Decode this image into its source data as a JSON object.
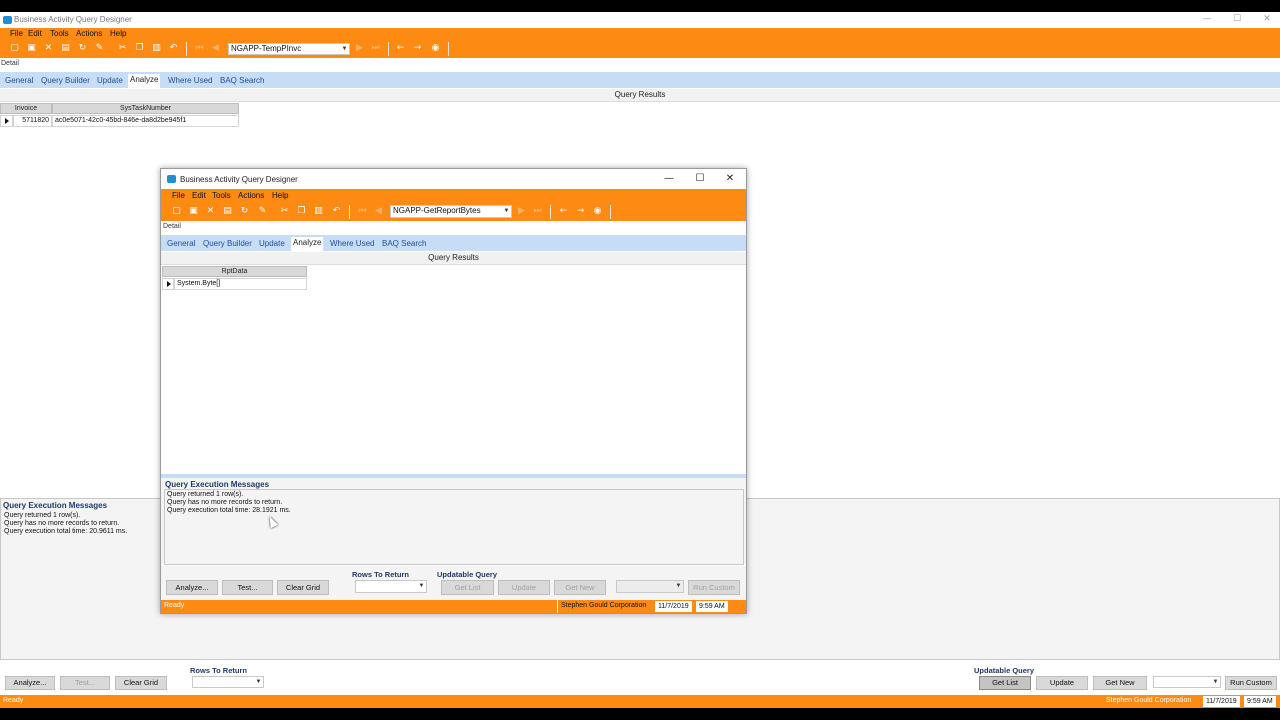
{
  "main": {
    "title": "Business Activity Query Designer",
    "menu": [
      "File",
      "Edit",
      "Tools",
      "Actions",
      "Help"
    ],
    "query_name": "NGAPP-TempPInvc",
    "detail_label": "Detail",
    "tabs": [
      "General",
      "Query Builder",
      "Update",
      "Analyze",
      "Where Used",
      "BAQ Search"
    ],
    "active_tab": "Analyze",
    "results_header": "Query Results",
    "grid": {
      "columns": [
        "Invoice",
        "SysTaskNumber"
      ],
      "rows": [
        [
          "5711820",
          "ac0e5071-42c0-45bd-846e-da8d2be945f1"
        ]
      ]
    },
    "messages": {
      "title": "Query Execution Messages",
      "lines": [
        "Query returned 1 row(s).",
        "Query has no more records to return.",
        "Query execution total time: 20.9611 ms."
      ]
    },
    "buttons": {
      "analyze": "Analyze...",
      "test": "Test...",
      "clear_grid": "Clear Grid",
      "get_list": "Get List",
      "update": "Update",
      "get_new": "Get New",
      "run_custom": "Run Custom"
    },
    "rows_to_return_label": "Rows To Return",
    "updatable_query_label": "Updatable Query",
    "status": {
      "text": "Ready",
      "company": "Stephen Gould Corporation",
      "date": "11/7/2019",
      "time": "9:59 AM"
    }
  },
  "child": {
    "title": "Business Activity Query Designer",
    "menu": [
      "File",
      "Edit",
      "Tools",
      "Actions",
      "Help"
    ],
    "query_name": "NGAPP-GetReportBytes",
    "detail_label": "Detail",
    "tabs": [
      "General",
      "Query Builder",
      "Update",
      "Analyze",
      "Where Used",
      "BAQ Search"
    ],
    "active_tab": "Analyze",
    "results_header": "Query Results",
    "grid": {
      "columns": [
        "RptData"
      ],
      "rows": [
        [
          "System.Byte[]"
        ]
      ]
    },
    "messages": {
      "title": "Query Execution Messages",
      "lines": [
        "Query returned 1 row(s).",
        "Query has no more records to return.",
        "Query execution total time: 28.1921 ms."
      ]
    },
    "buttons": {
      "analyze": "Analyze...",
      "test": "Test...",
      "clear_grid": "Clear Grid",
      "get_list": "Get List",
      "update": "Update",
      "get_new": "Get New",
      "run_custom": "Run Custom"
    },
    "rows_to_return_label": "Rows To Return",
    "updatable_query_label": "Updatable Query",
    "status": {
      "text": "Ready",
      "company": "Stephen Gould Corporation",
      "date": "11/7/2019",
      "time": "9:59 AM"
    }
  },
  "colors": {
    "accent": "#fd8a12",
    "tab_bar": "#c7ddf6",
    "link": "#1f4e9a"
  },
  "window_controls": {
    "minimize": "—",
    "maximize": "☐",
    "close": "✕"
  }
}
